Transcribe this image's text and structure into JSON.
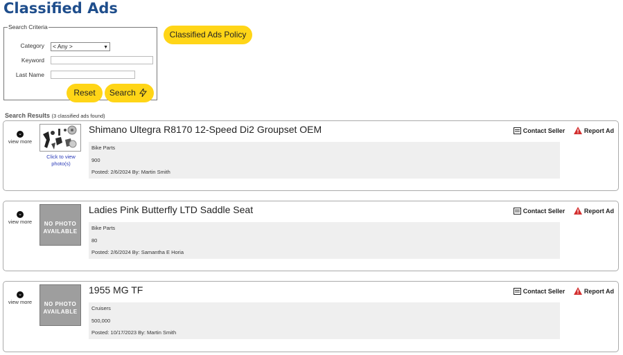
{
  "page": {
    "title": "Classified Ads"
  },
  "search": {
    "legend": "Search Criteria",
    "category_label": "Category",
    "category_value": "< Any >",
    "keyword_label": "Keyword",
    "keyword_value": "",
    "lastname_label": "Last Name",
    "lastname_value": "",
    "reset_label": "Reset",
    "search_label": "Search"
  },
  "policy_button": "Classified Ads Policy",
  "results": {
    "heading": "Search Results",
    "count_text": "(3 classified ads found)"
  },
  "ads": [
    {
      "title": "Shimano Ultegra R8170 12-Speed Di2 Groupset OEM",
      "category": "Bike Parts",
      "price": "900",
      "posted": "Posted: 2/6/2024   By: Martin Smith",
      "has_photo": true,
      "photo_caption": "Click to view photo(s)"
    },
    {
      "title": "Ladies Pink Butterfly LTD Saddle Seat",
      "category": "Bike Parts",
      "price": "80",
      "posted": "Posted: 2/6/2024   By: Samantha E Horia",
      "has_photo": false,
      "nophoto_text": "NO PHOTO AVAILABLE"
    },
    {
      "title": "1955 MG TF",
      "category": "Cruisers",
      "price": "500,000",
      "posted": "Posted: 10/17/2023   By: Martin Smith",
      "has_photo": false,
      "nophoto_text": "NO PHOTO AVAILABLE"
    }
  ],
  "common": {
    "view_more": "view more",
    "contact_seller": "Contact Seller",
    "report_ad": "Report Ad"
  },
  "colors": {
    "accent": "#ffd517",
    "title": "#1f4e8c",
    "report": "#d32f2f"
  }
}
